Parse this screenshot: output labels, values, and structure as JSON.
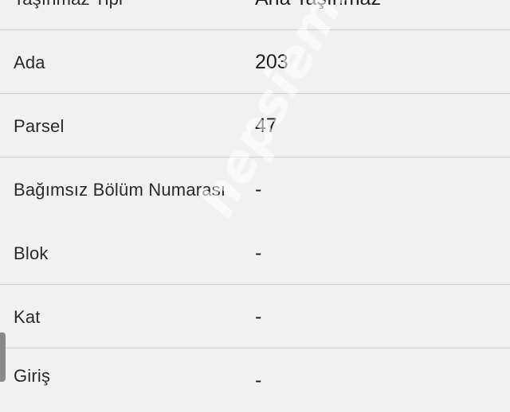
{
  "rows": [
    {
      "label": "Taşınmaz Tipi",
      "value": "Ana Taşınmaz"
    },
    {
      "label": "Ada",
      "value": "203"
    },
    {
      "label": "Parsel",
      "value": "47"
    },
    {
      "label": "Bağımsız Bölüm Numarası",
      "value": "-"
    },
    {
      "label": "Blok",
      "value": "-"
    },
    {
      "label": "Kat",
      "value": "-"
    },
    {
      "label": "Giriş",
      "value": "-"
    }
  ],
  "watermark": "hepsiemlak",
  "colors": {
    "background": "#f1f1f1",
    "divider": "#cfcfcf",
    "text": "#2a2a2a"
  }
}
